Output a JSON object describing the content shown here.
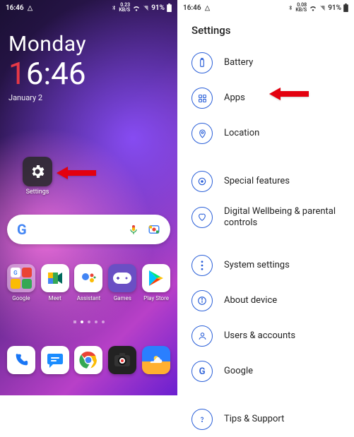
{
  "statusbar": {
    "time": "16:46",
    "net_rate": "0.23",
    "net_unit": "KB/S",
    "battery_pct": "91%"
  },
  "statusbar_right": {
    "time": "16:46",
    "net_rate": "0.08",
    "net_unit": "KB/S",
    "battery_pct": "91%"
  },
  "clock": {
    "day_of_week": "Monday",
    "time_first_digit": "1",
    "time_rest": "6:46",
    "date": "January 2"
  },
  "home_settings_icon_label": "Settings",
  "search": {
    "placeholder": ""
  },
  "apps_row": [
    {
      "label": "Google"
    },
    {
      "label": "Meet"
    },
    {
      "label": "Assistant"
    },
    {
      "label": "Games"
    },
    {
      "label": "Play Store"
    }
  ],
  "dock": [
    {
      "name": "phone"
    },
    {
      "name": "messages"
    },
    {
      "name": "chrome"
    },
    {
      "name": "camera"
    },
    {
      "name": "weather"
    }
  ],
  "page_indicator": {
    "count": 5,
    "active_index": 1
  },
  "settings": {
    "title": "Settings",
    "items": [
      {
        "icon": "battery",
        "label": "Battery"
      },
      {
        "icon": "apps",
        "label": "Apps"
      },
      {
        "icon": "location",
        "label": "Location"
      }
    ],
    "items2": [
      {
        "icon": "special",
        "label": "Special features"
      },
      {
        "icon": "wellbeing",
        "label": "Digital Wellbeing & parental controls"
      }
    ],
    "items3": [
      {
        "icon": "system",
        "label": "System settings"
      },
      {
        "icon": "about",
        "label": "About device"
      },
      {
        "icon": "users",
        "label": "Users & accounts"
      },
      {
        "icon": "google",
        "label": "Google"
      }
    ],
    "items4": [
      {
        "icon": "tips",
        "label": "Tips & Support"
      }
    ]
  },
  "colors": {
    "accent": "#2a5fd8",
    "arrow": "#e3000f"
  }
}
